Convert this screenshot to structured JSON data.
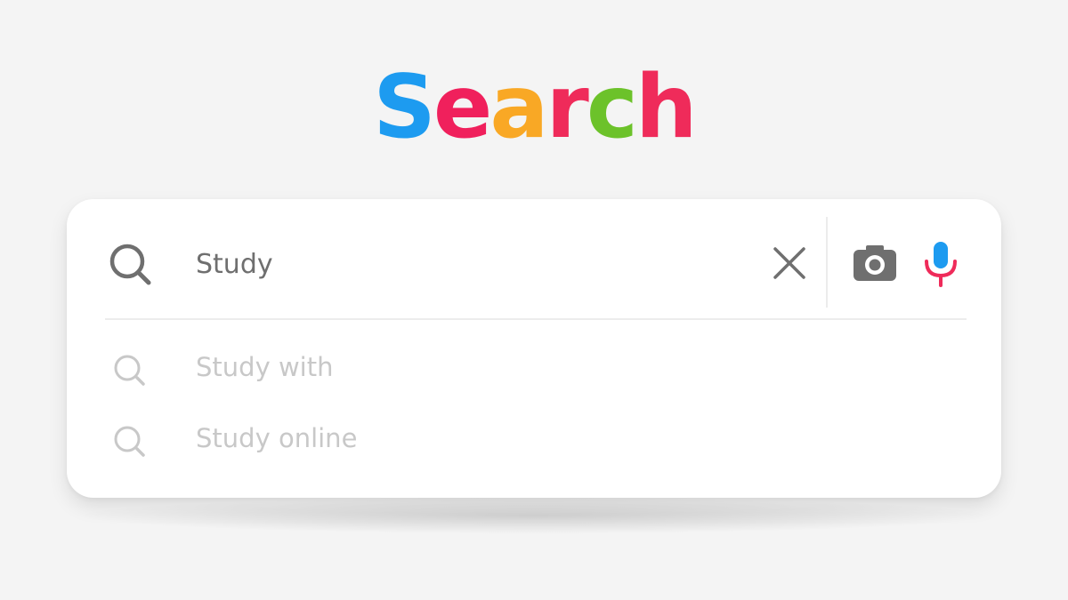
{
  "logo": {
    "letters": [
      {
        "char": "S",
        "color": "#1d9bf0"
      },
      {
        "char": "e",
        "color": "#f0205c"
      },
      {
        "char": "a",
        "color": "#f9a825"
      },
      {
        "char": "r",
        "color": "#ef2b5a"
      },
      {
        "char": "c",
        "color": "#6cc22a"
      },
      {
        "char": "h",
        "color": "#ef2b5a"
      }
    ]
  },
  "search": {
    "query": "Study",
    "icons": {
      "search": "search-icon",
      "clear": "close-icon",
      "camera": "camera-icon",
      "mic": "microphone-icon"
    },
    "mic_colors": {
      "head": "#1d9bf0",
      "stand": "#ef2b5a"
    }
  },
  "suggestions": [
    {
      "text": "Study with",
      "icon": "search-icon"
    },
    {
      "text": "Study online",
      "icon": "search-icon"
    }
  ]
}
